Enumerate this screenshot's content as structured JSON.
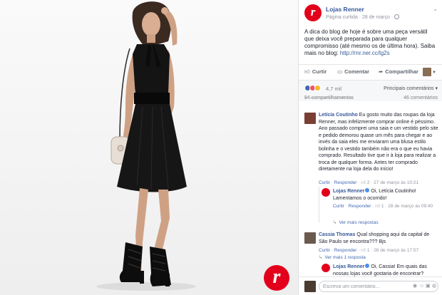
{
  "post": {
    "page_name": "Lojas Renner",
    "meta": "Página curtida · 28 de março ·",
    "logo_letter": "r",
    "text_main": "A dica do blog de hoje é sobre uma peça versátil que deixa você preparada para qualquer compromisso (até mesmo os de última hora). Saiba mais no blog: ",
    "text_link": "http://rnr.ner.cc/lg2s"
  },
  "actions": {
    "like": "Curtir",
    "comment": "Comentar",
    "share": "Compartilhar"
  },
  "reactions": {
    "count": "4,7 mil",
    "top_comments": "Principais comentários",
    "shares": "94 compartilhamentos",
    "comments": "46 comentários"
  },
  "comments": [
    {
      "author": "Letícia Coutinho",
      "text": "Eu gosto muito das roupas da loja Renner, mas infelizmente comprar online é péssimo. Ano passado comprei uma saia e um vestido pelo site e pedido demorou quase um mês para chegar e ao invés da saia eles me enviaram uma blusa estilo bolinha e o vestido também não era o que eu havia comprado. Resultado tive que ir à loja para realizar a troca de qualquer forma. Antes ter comprado diretamente na loja dela do início!",
      "meta_like": "Curtir",
      "meta_reply": "Responder",
      "meta_count": "2",
      "meta_time": "27 de março às 10:21"
    },
    {
      "author": "Lojas Renner",
      "text": "Oi, Letícia Coutinho! Lamentamos o ocorrido!",
      "meta_like": "Curtir",
      "meta_reply": "Responder",
      "meta_count": "1",
      "meta_time": "28 de março às 09:40"
    },
    {
      "author": "Cassia Thomas",
      "text": "Qual shopping aqui da capital de São Paulo se encontra??? Bjs",
      "meta_like": "Curtir",
      "meta_reply": "Responder",
      "meta_count": "1",
      "meta_time": "26 de março às 17:57"
    },
    {
      "author": "Lojas Renner",
      "text": "Oi, Cassia! Em quais das nossas lojas você gostaria de encontrar?"
    }
  ],
  "replies": {
    "more_replies_1": "Ver mais respostas",
    "more_replies_2": "Ver mais 1 resposta"
  },
  "compose": {
    "placeholder": "Escreva um comentário..."
  },
  "colors": {
    "brand_red": "#e2001a",
    "link_blue": "#365899",
    "dress": "#111111"
  },
  "icons": [
    "globe-icon",
    "options-icon",
    "like-icon",
    "comment-icon",
    "share-icon",
    "camera-icon",
    "emoji-icon",
    "gif-icon",
    "sticker-icon"
  ]
}
